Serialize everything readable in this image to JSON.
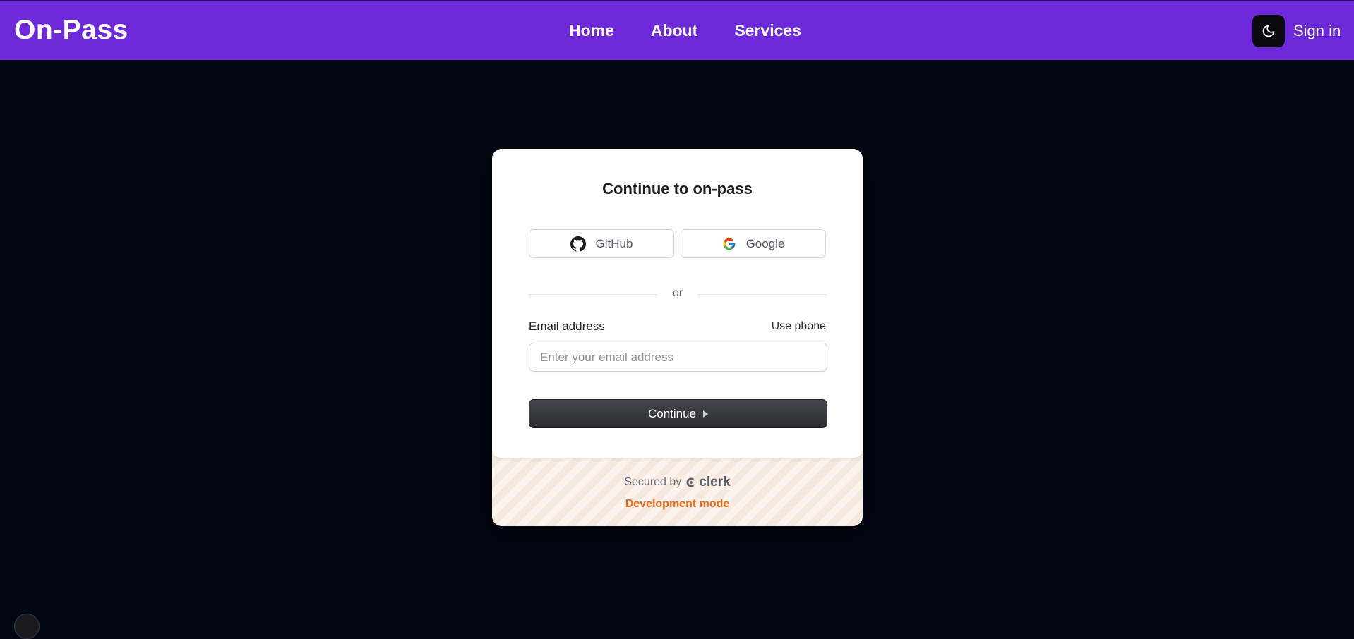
{
  "header": {
    "brand": "On-Pass",
    "nav": [
      "Home",
      "About",
      "Services"
    ],
    "theme_toggle_icon": "moon-icon",
    "sign_in": "Sign in"
  },
  "card": {
    "title": "Continue to on-pass",
    "social": {
      "github": "GitHub",
      "google": "Google"
    },
    "divider": "or",
    "email": {
      "label": "Email address",
      "alt_action": "Use phone",
      "placeholder": "Enter your email address",
      "value": ""
    },
    "continue": "Continue",
    "footer": {
      "secured_by": "Secured by",
      "provider": "clerk",
      "mode": "Development mode"
    }
  },
  "colors": {
    "header_bg": "#6d28d9",
    "page_bg": "#030712",
    "dev_mode": "#ea6a1a"
  }
}
